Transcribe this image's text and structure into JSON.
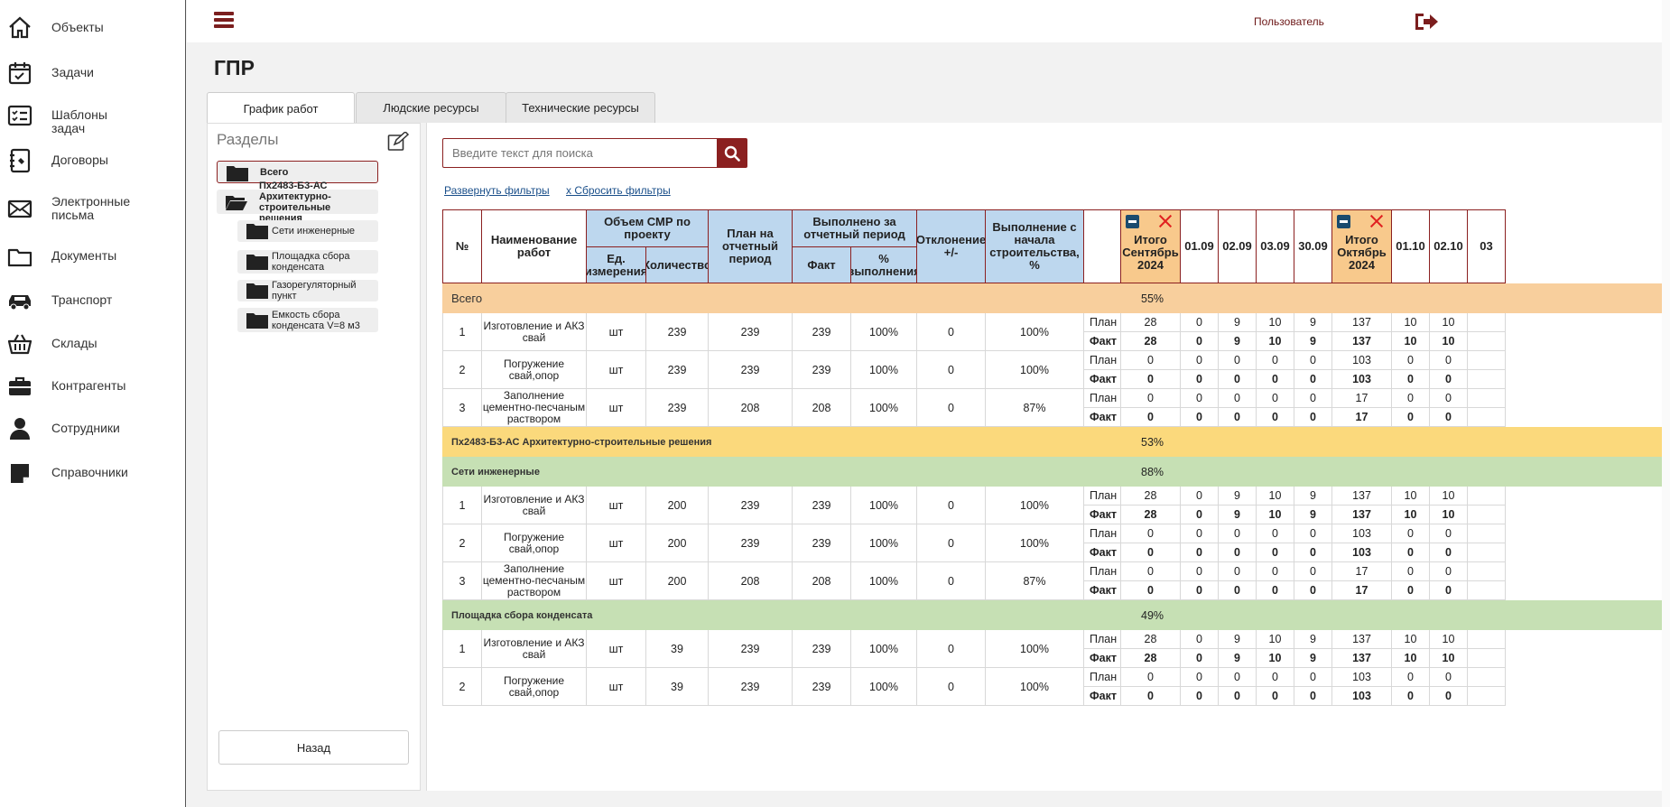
{
  "sidebar": {
    "items": [
      {
        "label": "Объекты",
        "icon": "home-icon"
      },
      {
        "label": "Задачи",
        "icon": "calendar-check-icon"
      },
      {
        "label": "Шаблоны задач",
        "icon": "checklist-icon"
      },
      {
        "label": "Договоры",
        "icon": "contract-book-icon"
      },
      {
        "label": "Электронные письма",
        "icon": "envelope-icon"
      },
      {
        "label": "Документы",
        "icon": "folder-icon"
      },
      {
        "label": "Транспорт",
        "icon": "car-icon"
      },
      {
        "label": "Склады",
        "icon": "basket-icon"
      },
      {
        "label": "Контрагенты",
        "icon": "briefcase-icon"
      },
      {
        "label": "Сотрудники",
        "icon": "person-icon"
      },
      {
        "label": "Справочники",
        "icon": "notes-icon"
      }
    ]
  },
  "header": {
    "user": "Пользователь"
  },
  "page": {
    "title": "ГПР"
  },
  "tabs": [
    "График работ",
    "Людские ресурсы",
    "Технические ресурсы"
  ],
  "sections": {
    "title": "Разделы",
    "items": [
      {
        "label": "Всего"
      },
      {
        "label": "Пх2483-Б3-АС Архитектурно-строительные решения"
      },
      {
        "label": "Сети инженерные"
      },
      {
        "label": "Площадка сбора конденсата"
      },
      {
        "label": "Газорегуляторный пункт"
      },
      {
        "label": "Емкость сбора конденсата V=8 м3"
      }
    ],
    "back": "Назад"
  },
  "search": {
    "placeholder": "Введите текст для поиска"
  },
  "filters": {
    "expand": "Развернуть фильтры",
    "reset": "x Сбросить фильтры"
  },
  "table": {
    "headers": {
      "num": "№",
      "name": "Наименование работ",
      "volume": "Объем СМР по проекту",
      "unit": "Ед. измерения",
      "qty": "Количество",
      "plan": "План на отчетный период",
      "done": "Выполнено за отчетный период",
      "fact": "Факт",
      "pct": "% выполнения",
      "dev": "Отклонение +/-",
      "total": "Выполнение с начала строительства, %",
      "sep_total": "Итого Сентябрь 2024",
      "oct_total": "Итого Октябрь 2024",
      "dates": [
        "01.09",
        "02.09",
        "03.09",
        "30.09",
        "01.10",
        "02.10",
        "03"
      ]
    },
    "plan_label": "План",
    "fact_label": "Факт",
    "groups": [
      {
        "title": "Всего",
        "pct": "55%",
        "color": "#f8cf9d",
        "rows": [
          {
            "n": "1",
            "name": "Изготовление и АКЗ свай",
            "unit": "шт",
            "qty": "239",
            "plan": "239",
            "fact": "239",
            "pctDone": "100%",
            "dev": "0",
            "total": "100%",
            "p": [
              "28",
              "0",
              "9",
              "10",
              "9",
              "137",
              "10",
              "10"
            ],
            "f": [
              "28",
              "0",
              "9",
              "10",
              "9",
              "137",
              "10",
              "10"
            ]
          },
          {
            "n": "2",
            "name": "Погружение свай,опор",
            "unit": "шт",
            "qty": "239",
            "plan": "239",
            "fact": "239",
            "pctDone": "100%",
            "dev": "0",
            "total": "100%",
            "p": [
              "0",
              "0",
              "0",
              "0",
              "0",
              "103",
              "0",
              "0"
            ],
            "f": [
              "0",
              "0",
              "0",
              "0",
              "0",
              "103",
              "0",
              "0"
            ]
          },
          {
            "n": "3",
            "name": "Заполнение цементно-песчаным раствором",
            "unit": "шт",
            "qty": "239",
            "plan": "208",
            "fact": "208",
            "pctDone": "100%",
            "dev": "0",
            "total": "87%",
            "p": [
              "0",
              "0",
              "0",
              "0",
              "0",
              "17",
              "0",
              "0"
            ],
            "f": [
              "0",
              "0",
              "0",
              "0",
              "0",
              "17",
              "0",
              "0"
            ]
          }
        ]
      },
      {
        "title": "Пх2483-Б3-АС Архитектурно-строительные решения",
        "pct": "53%",
        "color": "#fbd97c",
        "rows": []
      },
      {
        "title": "Сети инженерные",
        "pct": "88%",
        "color": "#c6e0b4",
        "rows": [
          {
            "n": "1",
            "name": "Изготовление и АКЗ свай",
            "unit": "шт",
            "qty": "200",
            "plan": "239",
            "fact": "239",
            "pctDone": "100%",
            "dev": "0",
            "total": "100%",
            "p": [
              "28",
              "0",
              "9",
              "10",
              "9",
              "137",
              "10",
              "10"
            ],
            "f": [
              "28",
              "0",
              "9",
              "10",
              "9",
              "137",
              "10",
              "10"
            ]
          },
          {
            "n": "2",
            "name": "Погружение свай,опор",
            "unit": "шт",
            "qty": "200",
            "plan": "239",
            "fact": "239",
            "pctDone": "100%",
            "dev": "0",
            "total": "100%",
            "p": [
              "0",
              "0",
              "0",
              "0",
              "0",
              "103",
              "0",
              "0"
            ],
            "f": [
              "0",
              "0",
              "0",
              "0",
              "0",
              "103",
              "0",
              "0"
            ]
          },
          {
            "n": "3",
            "name": "Заполнение цементно-песчаным раствором",
            "unit": "шт",
            "qty": "200",
            "plan": "208",
            "fact": "208",
            "pctDone": "100%",
            "dev": "0",
            "total": "87%",
            "p": [
              "0",
              "0",
              "0",
              "0",
              "0",
              "17",
              "0",
              "0"
            ],
            "f": [
              "0",
              "0",
              "0",
              "0",
              "0",
              "17",
              "0",
              "0"
            ]
          }
        ]
      },
      {
        "title": "Площадка сбора конденсата",
        "pct": "49%",
        "color": "#c6e0b4",
        "rows": [
          {
            "n": "1",
            "name": "Изготовление и АКЗ свай",
            "unit": "шт",
            "qty": "39",
            "plan": "239",
            "fact": "239",
            "pctDone": "100%",
            "dev": "0",
            "total": "100%",
            "p": [
              "28",
              "0",
              "9",
              "10",
              "9",
              "137",
              "10",
              "10"
            ],
            "f": [
              "28",
              "0",
              "9",
              "10",
              "9",
              "137",
              "10",
              "10"
            ]
          },
          {
            "n": "2",
            "name": "Погружение свай,опор",
            "unit": "шт",
            "qty": "39",
            "plan": "239",
            "fact": "239",
            "pctDone": "100%",
            "dev": "0",
            "total": "100%",
            "p": [
              "0",
              "0",
              "0",
              "0",
              "0",
              "103",
              "0",
              "0"
            ],
            "f": [
              "0",
              "0",
              "0",
              "0",
              "0",
              "103",
              "0",
              "0"
            ]
          }
        ]
      }
    ]
  }
}
